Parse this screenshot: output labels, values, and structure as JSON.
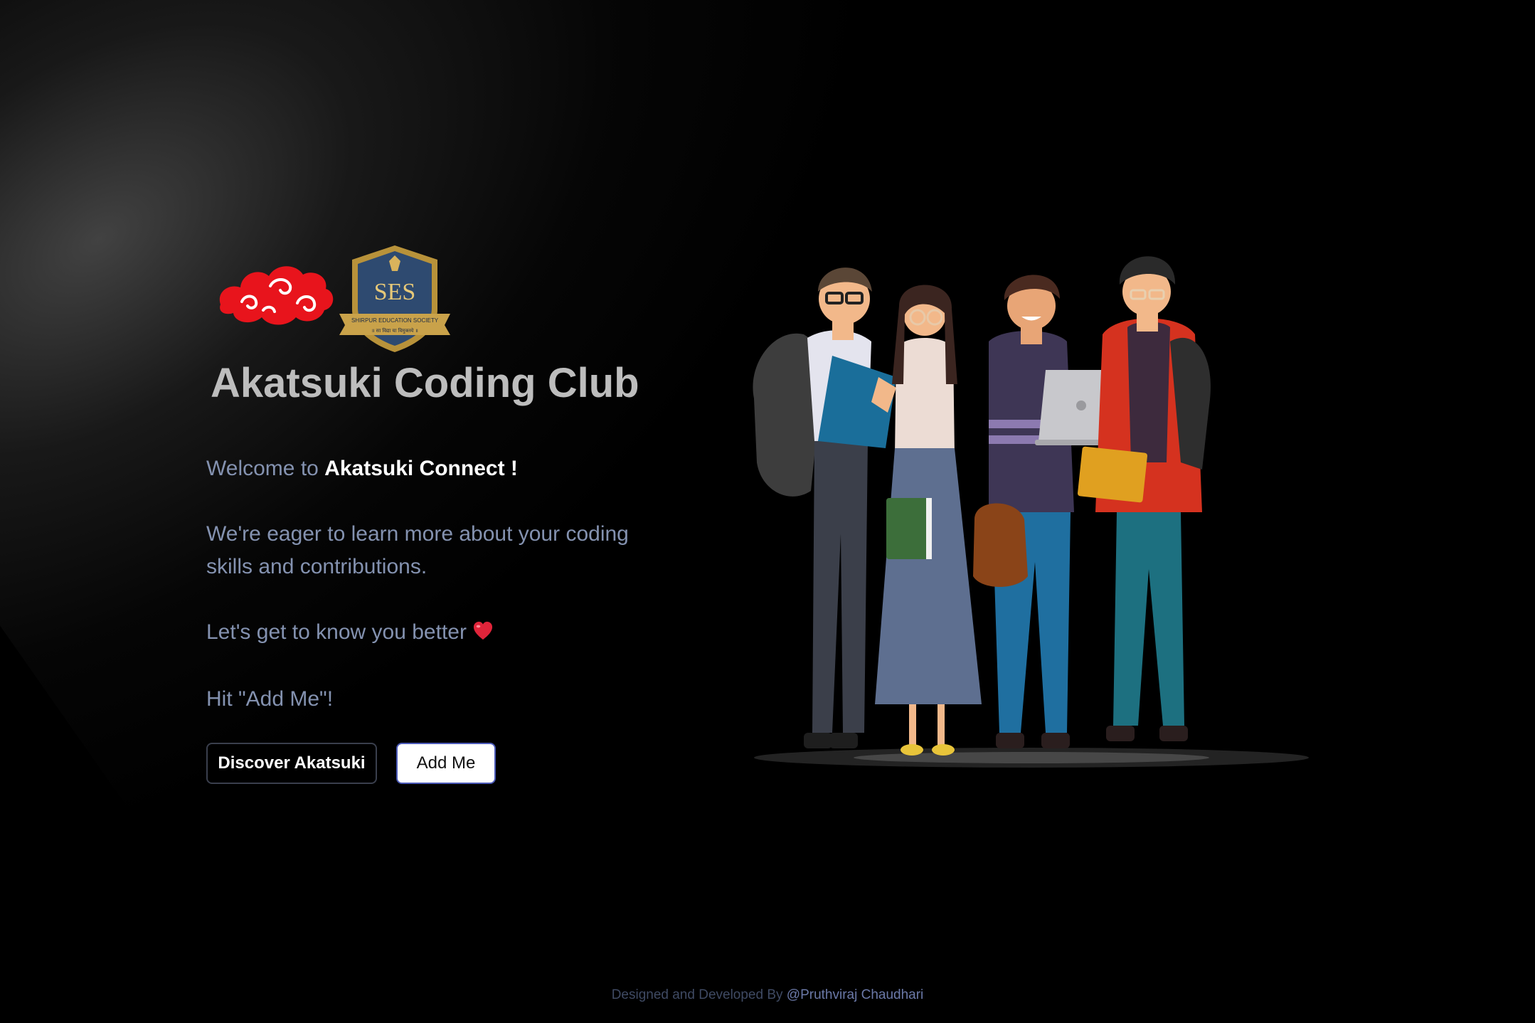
{
  "hero": {
    "title": "Akatsuki Coding Club",
    "welcome_prefix": "Welcome to ",
    "welcome_brand": "Akatsuki Connect !",
    "paragraph_eager": "We're eager to learn more about your coding skills and contributions.",
    "paragraph_know": "Let's get to know you better",
    "paragraph_hit": "Hit \"Add Me\"!",
    "logo_ses_text": "SES",
    "logo_ses_ribbon": "SHIRPUR EDUCATION SOCIETY",
    "logo_ses_motto": "॥ सा विद्या या विमुक्तये ॥"
  },
  "buttons": {
    "discover_label": "Discover Akatsuki",
    "add_label": "Add Me"
  },
  "footer": {
    "prefix": "Designed and Developed By ",
    "author": "@Pruthviraj Chaudhari"
  },
  "colors": {
    "background": "#000000",
    "title": "#bdbdbd",
    "body_text": "#8492b0",
    "cloud_red": "#e8141c",
    "heart": "#e0243a"
  },
  "icons": {
    "cloud": "akatsuki-cloud-icon",
    "heart": "heart-icon"
  }
}
